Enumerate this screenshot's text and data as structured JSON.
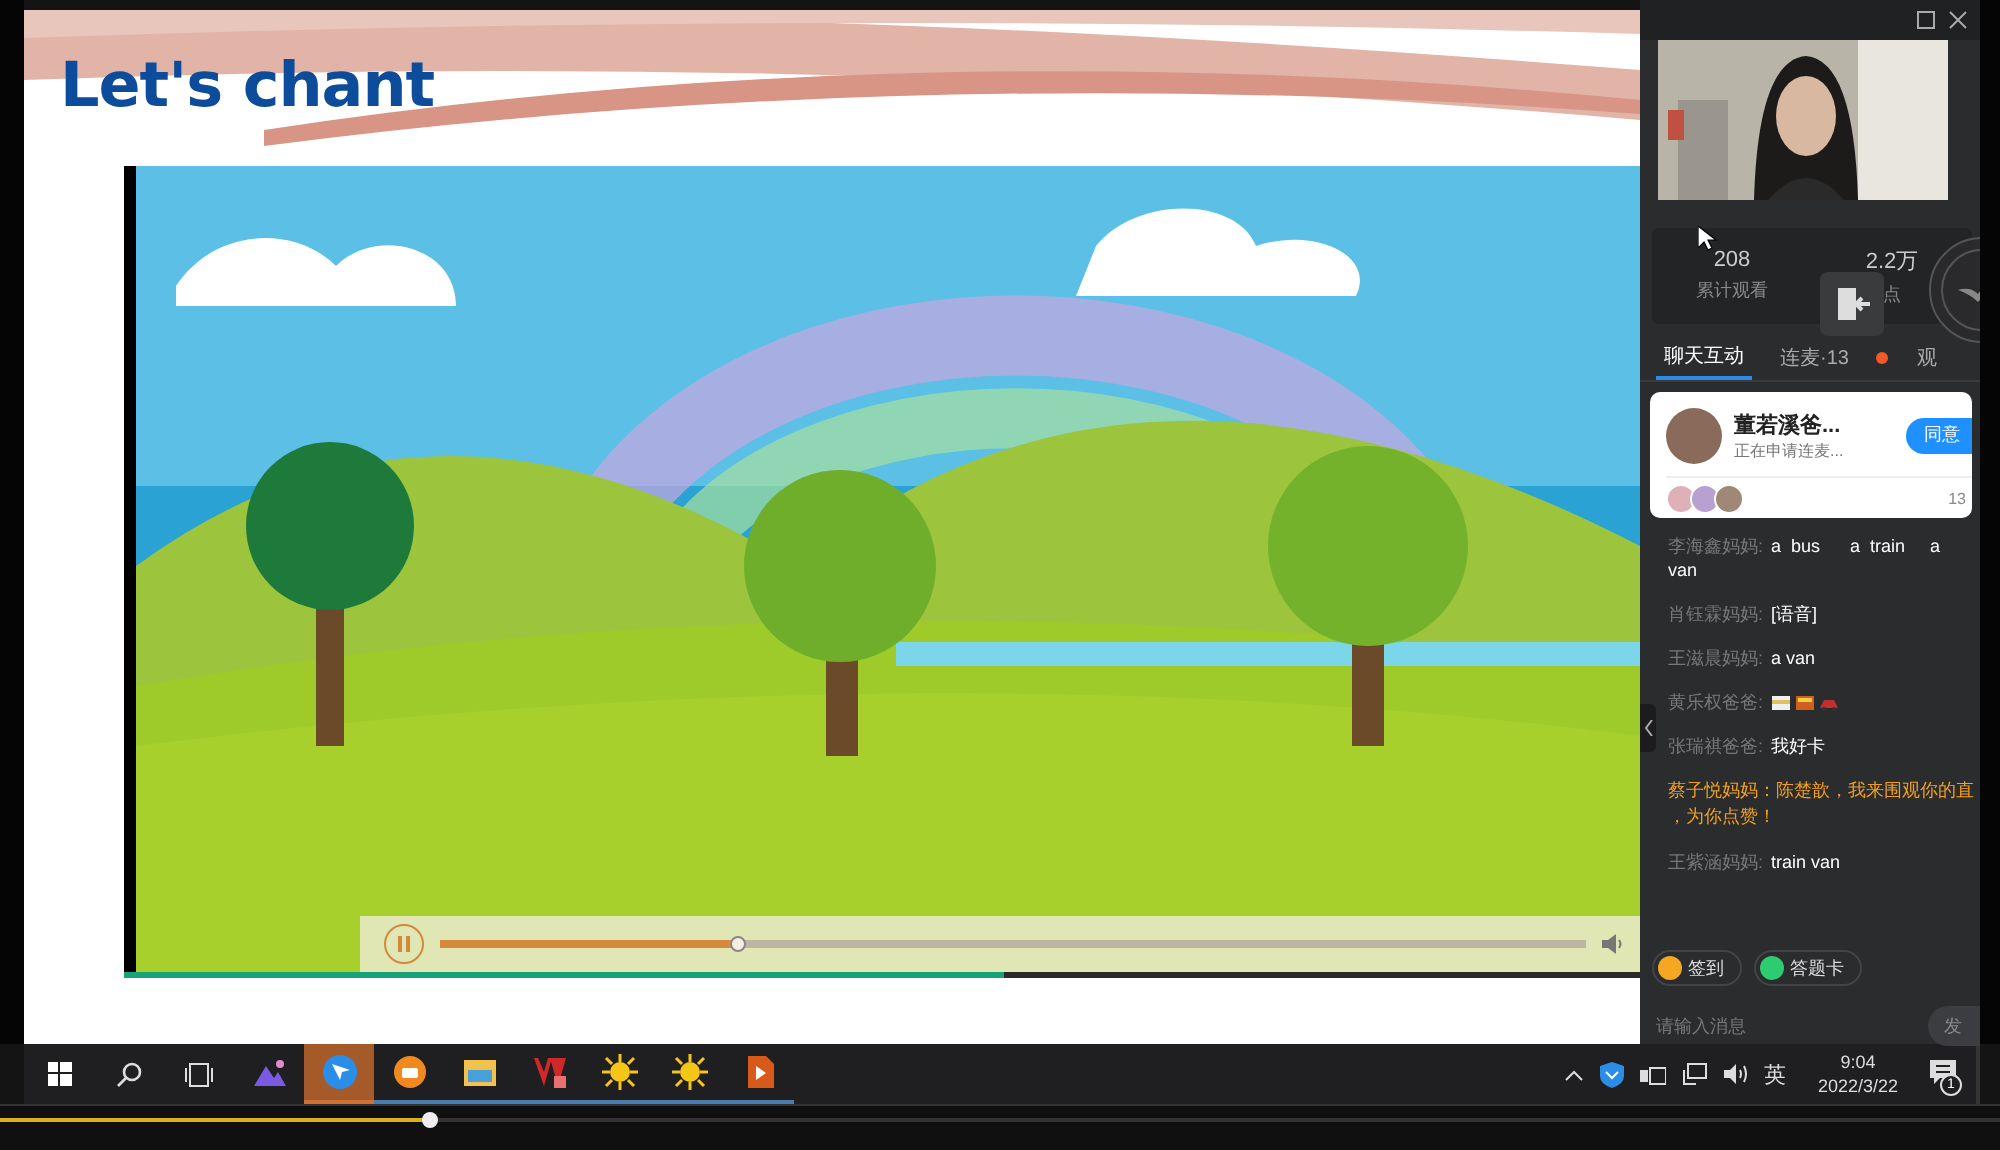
{
  "slide": {
    "title": "Let's chant",
    "video": {
      "kind": "picture",
      "buffer": {
        "level": 0.58
      },
      "player": {
        "playing": true,
        "level": 0.26
      }
    }
  },
  "panel": {
    "stats": [
      {
        "value": "208",
        "label": "累计观看"
      },
      {
        "value": "2.2万",
        "label": "点"
      }
    ],
    "tabs": [
      {
        "label": "聊天互动",
        "selected": true,
        "dot": false
      },
      {
        "label": "连麦·13",
        "selected": false,
        "dot": true
      },
      {
        "label": "观",
        "selected": false,
        "dot": false
      }
    ],
    "request": {
      "name": "董若溪爸...",
      "status": "正在申请连麦...",
      "button": "同意",
      "count": "13"
    },
    "messages": [
      {
        "kind": "text",
        "sender": "李海鑫妈妈:",
        "text": "a  bus      a  train     a van"
      },
      {
        "kind": "text",
        "sender": "肖钰霖妈妈:",
        "text": "[语音]"
      },
      {
        "kind": "text",
        "sender": "王滋晨妈妈:",
        "text": "a van"
      },
      {
        "kind": "emoji",
        "sender": "黄乐权爸爸:"
      },
      {
        "kind": "text",
        "sender": "张瑞祺爸爸:",
        "text": "我好卡"
      },
      {
        "kind": "notice",
        "lines": [
          "蔡子悦妈妈：陈楚歆，我来围观你的直",
          "，为你点赞！"
        ]
      },
      {
        "kind": "text",
        "sender": "王紫涵妈妈:",
        "text": "train van"
      }
    ],
    "quick": [
      {
        "label": "签到",
        "color": "#f5a623"
      },
      {
        "label": "答题卡",
        "color": "#2ecc71"
      }
    ],
    "input": {
      "placeholder": "请输入消息",
      "send": "发"
    }
  },
  "taskbar": {
    "apps": [
      {
        "kind": "photos",
        "active": false
      },
      {
        "kind": "arrow",
        "active": true
      },
      {
        "kind": "camera",
        "active": false
      },
      {
        "kind": "folder",
        "active": false
      },
      {
        "kind": "doc",
        "active": false
      },
      {
        "kind": "sun",
        "active": false
      },
      {
        "kind": "sun",
        "active": false
      },
      {
        "kind": "play",
        "active": false
      }
    ],
    "ime": "英",
    "time": "9:04",
    "date": "2022/3/22",
    "notifications": "1"
  },
  "timeline": {
    "level": 0.215
  }
}
